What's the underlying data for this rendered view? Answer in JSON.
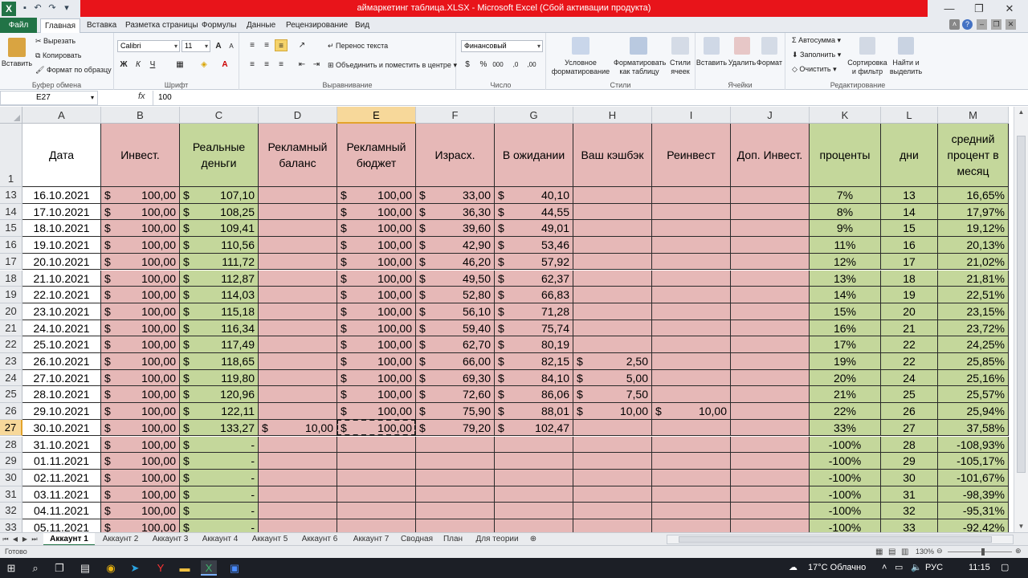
{
  "window": {
    "title": "аймаркетинг таблица.XLSX  -  Microsoft Excel (Сбой активации продукта)",
    "qa_icons": [
      "save-icon",
      "undo-icon",
      "redo-icon",
      "customize-icon"
    ]
  },
  "ribbon_tabs": [
    "Файл",
    "Главная",
    "Вставка",
    "Разметка страницы",
    "Формулы",
    "Данные",
    "Рецензирование",
    "Вид"
  ],
  "ribbon": {
    "clipboard": {
      "paste": "Вставить",
      "cut": "Вырезать",
      "copy": "Копировать",
      "format_painter": "Формат по образцу",
      "label": "Буфер обмена"
    },
    "font": {
      "name": "Calibri",
      "size": "11",
      "bold": "Ж",
      "italic": "К",
      "underline": "Ч",
      "grow": "A",
      "shrink": "A",
      "label": "Шрифт"
    },
    "alignment": {
      "wrap": "Перенос текста",
      "merge": "Объединить и поместить в центре",
      "label": "Выравнивание"
    },
    "number": {
      "format": "Финансовый",
      "currency": "$",
      "percent": "%",
      "comma": "000",
      "inc_dec": ",0",
      "dec_dec": ",00",
      "label": "Число"
    },
    "styles": {
      "conditional": "Условное форматирование",
      "as_table": "Форматировать как таблицу",
      "cell_styles": "Стили ячеек",
      "label": "Стили"
    },
    "cells": {
      "insert": "Вставить",
      "delete": "Удалить",
      "format": "Формат",
      "label": "Ячейки"
    },
    "editing": {
      "autosum": "Автосумма",
      "fill": "Заполнить",
      "clear": "Очистить",
      "sort": "Сортировка и фильтр",
      "find": "Найти и выделить",
      "label": "Редактирование"
    }
  },
  "formula_bar": {
    "name_box": "E27",
    "fx": "fx",
    "value": "100"
  },
  "columns": [
    "A",
    "B",
    "C",
    "D",
    "E",
    "F",
    "G",
    "H",
    "I",
    "J",
    "K",
    "L",
    "M"
  ],
  "selected_column": "E",
  "header_row": {
    "row_num": "1",
    "labels": [
      "Дата",
      "Инвест.",
      "Реальные деньги",
      "Рекламный баланс",
      "Рекламный бюджет",
      "Израсх.",
      "В ожидании",
      "Ваш кэшбэк",
      "Реинвест",
      "Доп. Инвест.",
      "проценты",
      "дни",
      "средний процент в месяц"
    ]
  },
  "currency_symbol": "$",
  "rows": [
    {
      "n": "13",
      "date": "16.10.2021",
      "b": "100,00",
      "c": "107,10",
      "d": "",
      "e": "100,00",
      "f": "33,00",
      "g": "40,10",
      "h": "",
      "i": "",
      "k": "7%",
      "l": "13",
      "m": "16,65%"
    },
    {
      "n": "14",
      "date": "17.10.2021",
      "b": "100,00",
      "c": "108,25",
      "d": "",
      "e": "100,00",
      "f": "36,30",
      "g": "44,55",
      "h": "",
      "i": "",
      "k": "8%",
      "l": "14",
      "m": "17,97%"
    },
    {
      "n": "15",
      "date": "18.10.2021",
      "b": "100,00",
      "c": "109,41",
      "d": "",
      "e": "100,00",
      "f": "39,60",
      "g": "49,01",
      "h": "",
      "i": "",
      "k": "9%",
      "l": "15",
      "m": "19,12%"
    },
    {
      "n": "16",
      "date": "19.10.2021",
      "b": "100,00",
      "c": "110,56",
      "d": "",
      "e": "100,00",
      "f": "42,90",
      "g": "53,46",
      "h": "",
      "i": "",
      "k": "11%",
      "l": "16",
      "m": "20,13%"
    },
    {
      "n": "17",
      "date": "20.10.2021",
      "b": "100,00",
      "c": "111,72",
      "d": "",
      "e": "100,00",
      "f": "46,20",
      "g": "57,92",
      "h": "",
      "i": "",
      "k": "12%",
      "l": "17",
      "m": "21,02%"
    },
    {
      "n": "18",
      "date": "21.10.2021",
      "b": "100,00",
      "c": "112,87",
      "d": "",
      "e": "100,00",
      "f": "49,50",
      "g": "62,37",
      "h": "",
      "i": "",
      "k": "13%",
      "l": "18",
      "m": "21,81%"
    },
    {
      "n": "19",
      "date": "22.10.2021",
      "b": "100,00",
      "c": "114,03",
      "d": "",
      "e": "100,00",
      "f": "52,80",
      "g": "66,83",
      "h": "",
      "i": "",
      "k": "14%",
      "l": "19",
      "m": "22,51%"
    },
    {
      "n": "20",
      "date": "23.10.2021",
      "b": "100,00",
      "c": "115,18",
      "d": "",
      "e": "100,00",
      "f": "56,10",
      "g": "71,28",
      "h": "",
      "i": "",
      "k": "15%",
      "l": "20",
      "m": "23,15%"
    },
    {
      "n": "21",
      "date": "24.10.2021",
      "b": "100,00",
      "c": "116,34",
      "d": "",
      "e": "100,00",
      "f": "59,40",
      "g": "75,74",
      "h": "",
      "i": "",
      "k": "16%",
      "l": "21",
      "m": "23,72%"
    },
    {
      "n": "22",
      "date": "25.10.2021",
      "b": "100,00",
      "c": "117,49",
      "d": "",
      "e": "100,00",
      "f": "62,70",
      "g": "80,19",
      "h": "",
      "i": "",
      "k": "17%",
      "l": "22",
      "m": "24,25%"
    },
    {
      "n": "23",
      "date": "26.10.2021",
      "b": "100,00",
      "c": "118,65",
      "d": "",
      "e": "100,00",
      "f": "66,00",
      "g": "82,15",
      "h": "2,50",
      "i": "",
      "k": "19%",
      "l": "22",
      "m": "25,85%"
    },
    {
      "n": "24",
      "date": "27.10.2021",
      "b": "100,00",
      "c": "119,80",
      "d": "",
      "e": "100,00",
      "f": "69,30",
      "g": "84,10",
      "h": "5,00",
      "i": "",
      "k": "20%",
      "l": "24",
      "m": "25,16%"
    },
    {
      "n": "25",
      "date": "28.10.2021",
      "b": "100,00",
      "c": "120,96",
      "d": "",
      "e": "100,00",
      "f": "72,60",
      "g": "86,06",
      "h": "7,50",
      "i": "",
      "k": "21%",
      "l": "25",
      "m": "25,57%"
    },
    {
      "n": "26",
      "date": "29.10.2021",
      "b": "100,00",
      "c": "122,11",
      "d": "",
      "e": "100,00",
      "f": "75,90",
      "g": "88,01",
      "h": "10,00",
      "i": "10,00",
      "k": "22%",
      "l": "26",
      "m": "25,94%"
    },
    {
      "n": "27",
      "date": "30.10.2021",
      "b": "100,00",
      "c": "133,27",
      "d": "10,00",
      "e": "100,00",
      "f": "79,20",
      "g": "102,47",
      "h": "",
      "i": "",
      "k": "33%",
      "l": "27",
      "m": "37,58%"
    },
    {
      "n": "28",
      "date": "31.10.2021",
      "b": "100,00",
      "c": "-",
      "d": "",
      "e": "",
      "f": "",
      "g": "",
      "h": "",
      "i": "",
      "k": "-100%",
      "l": "28",
      "m": "-108,93%"
    },
    {
      "n": "29",
      "date": "01.11.2021",
      "b": "100,00",
      "c": "-",
      "d": "",
      "e": "",
      "f": "",
      "g": "",
      "h": "",
      "i": "",
      "k": "-100%",
      "l": "29",
      "m": "-105,17%"
    },
    {
      "n": "30",
      "date": "02.11.2021",
      "b": "100,00",
      "c": "-",
      "d": "",
      "e": "",
      "f": "",
      "g": "",
      "h": "",
      "i": "",
      "k": "-100%",
      "l": "30",
      "m": "-101,67%"
    },
    {
      "n": "31",
      "date": "03.11.2021",
      "b": "100,00",
      "c": "-",
      "d": "",
      "e": "",
      "f": "",
      "g": "",
      "h": "",
      "i": "",
      "k": "-100%",
      "l": "31",
      "m": "-98,39%"
    },
    {
      "n": "32",
      "date": "04.11.2021",
      "b": "100,00",
      "c": "-",
      "d": "",
      "e": "",
      "f": "",
      "g": "",
      "h": "",
      "i": "",
      "k": "-100%",
      "l": "32",
      "m": "-95,31%"
    },
    {
      "n": "33",
      "date": "05.11.2021",
      "b": "100,00",
      "c": "-",
      "d": "",
      "e": "",
      "f": "",
      "g": "",
      "h": "",
      "i": "",
      "k": "-100%",
      "l": "33",
      "m": "-92,42%"
    }
  ],
  "selected_row": "27",
  "sheet_tabs": [
    "Аккаунт 1",
    "Аккаунт 2",
    "Аккаунт 3",
    "Аккаунт 4",
    "Аккаунт 5",
    "Аккаунт 6",
    "Аккаунт 7",
    "Сводная",
    "План",
    "Для теории"
  ],
  "status": {
    "ready": "Готово",
    "zoom": "130%"
  },
  "taskbar": {
    "weather": "17°C Облачно",
    "lang": "РУС",
    "time": "11:15"
  },
  "colors": {
    "pink": "#e6b8b7",
    "green": "#c4d79b",
    "excel_green": "#217346",
    "title_red": "#e8141a",
    "selected_header": "#f7d89a"
  }
}
